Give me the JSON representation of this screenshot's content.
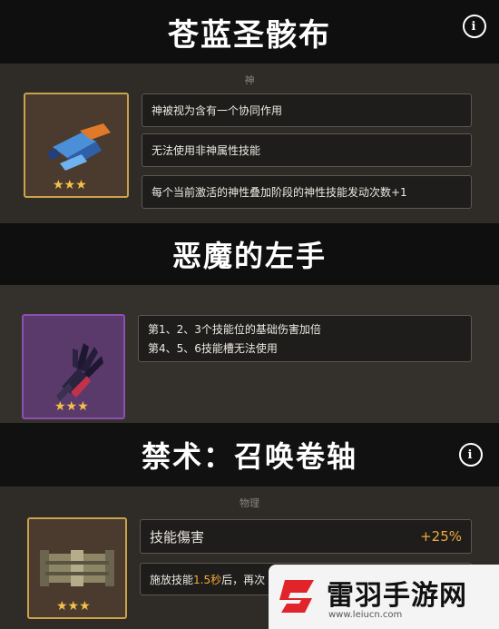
{
  "item1": {
    "title": "苍蓝圣骸布",
    "category": "神",
    "stars": "★★★",
    "effects": [
      "神被视为含有一个协同作用",
      "无法使用非神属性技能",
      "每个当前激活的神性叠加阶段的神性技能发动次数+1"
    ]
  },
  "item2": {
    "title": "恶魔的左手",
    "stars": "★★★",
    "effects": [
      "第1、2、3个技能位的基础伤害加倍",
      "第4、5、6技能槽无法使用"
    ]
  },
  "item3": {
    "title": "禁术：召唤卷轴",
    "category": "物理",
    "stars": "★★★",
    "stat_label": "技能傷害",
    "stat_value": "+25%",
    "effect_prefix": "施放技能",
    "effect_highlight": "1.5秒",
    "effect_suffix": "后，再次"
  },
  "watermark": {
    "name": "雷羽手游网",
    "url": "www.leiucn.com"
  },
  "colors": {
    "gold_border": "#c9a24a",
    "purple_border": "#8e4fb0",
    "highlight": "#f0a83a"
  }
}
